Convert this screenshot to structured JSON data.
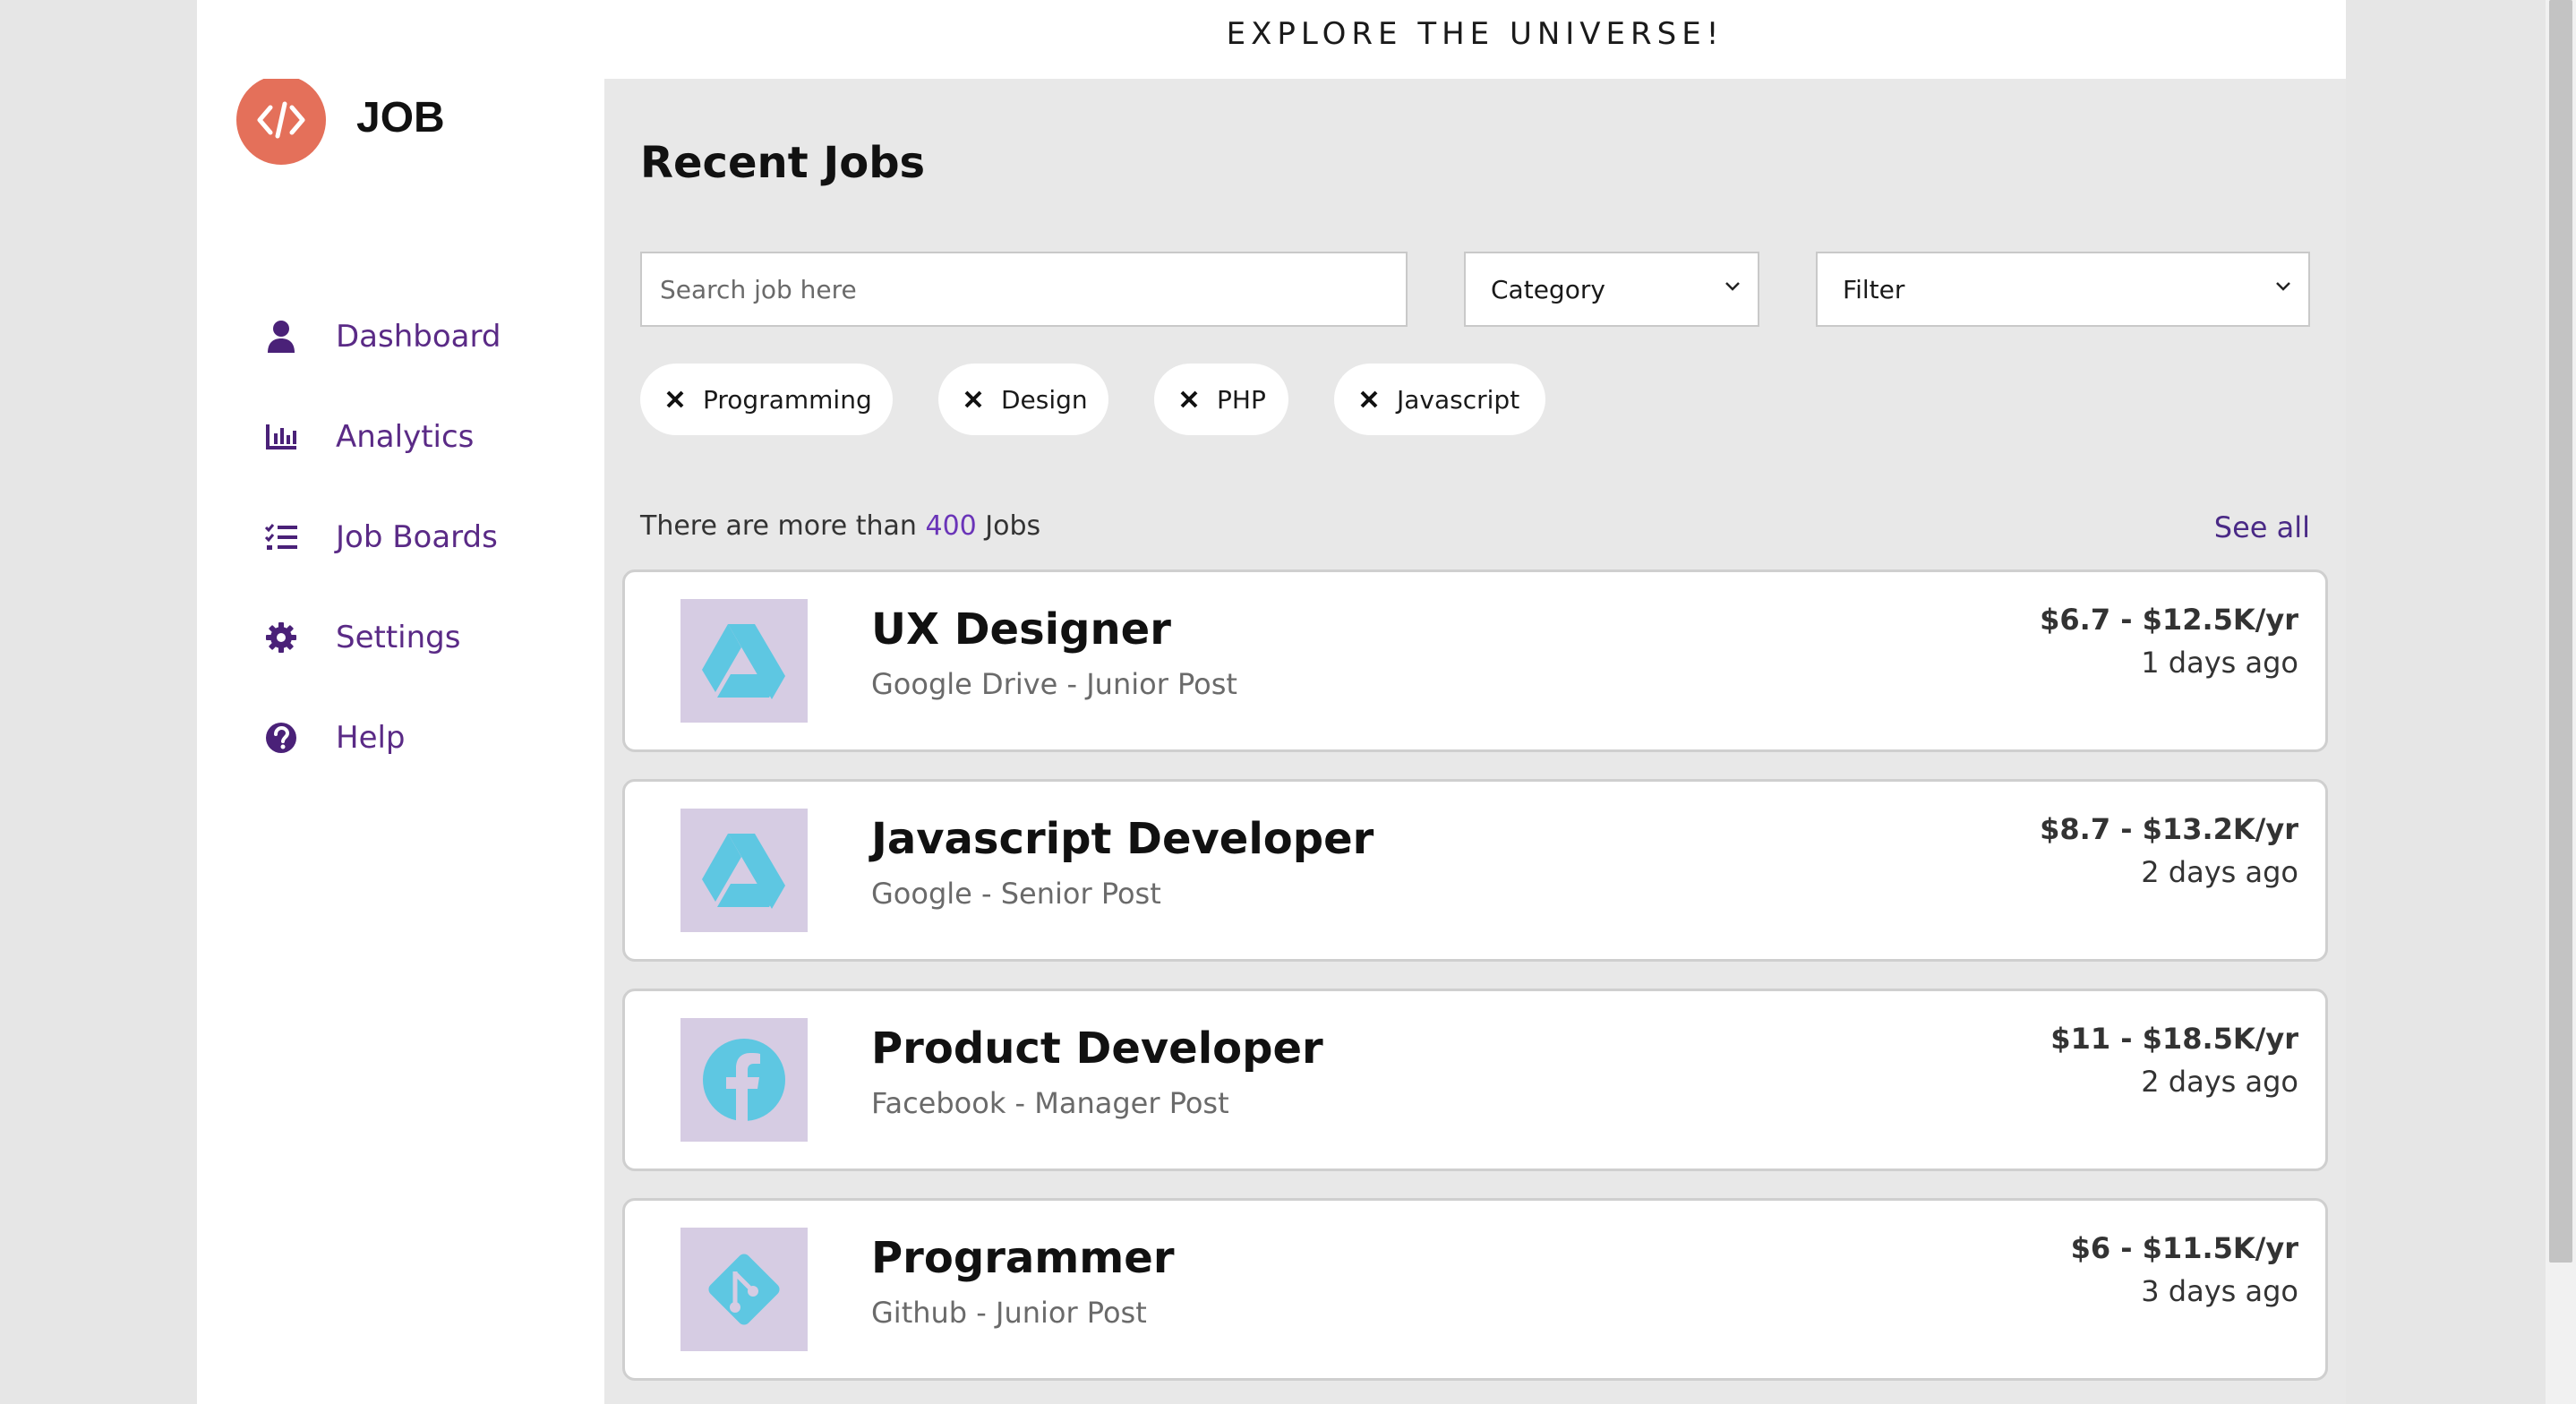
{
  "banner": {
    "text": "EXPLORE THE UNIVERSE!"
  },
  "brand": {
    "name": "JOB"
  },
  "sidebar": {
    "items": [
      {
        "label": "Dashboard",
        "icon": "user-icon"
      },
      {
        "label": "Analytics",
        "icon": "bar-chart-icon"
      },
      {
        "label": "Job Boards",
        "icon": "checklist-icon"
      },
      {
        "label": "Settings",
        "icon": "gear-icon"
      },
      {
        "label": "Help",
        "icon": "question-icon"
      }
    ]
  },
  "main": {
    "title": "Recent Jobs",
    "search": {
      "placeholder": "Search job here",
      "value": ""
    },
    "category_select": {
      "value": "Category"
    },
    "filter_select": {
      "value": "Filter"
    },
    "tags": [
      "Programming",
      "Design",
      "PHP",
      "Javascript"
    ],
    "count": {
      "prefix": "There are more than ",
      "number": "400",
      "suffix": " Jobs"
    },
    "see_all": "See all",
    "jobs": [
      {
        "title": "UX Designer",
        "subtitle": "Google Drive - Junior Post",
        "salary": "$6.7 - $12.5K/yr",
        "ago": "1 days ago",
        "logo": "google-drive-icon"
      },
      {
        "title": "Javascript Developer",
        "subtitle": "Google - Senior Post",
        "salary": "$8.7 - $13.2K/yr",
        "ago": "2 days ago",
        "logo": "google-drive-icon"
      },
      {
        "title": "Product Developer",
        "subtitle": "Facebook - Manager Post",
        "salary": "$11 - $18.5K/yr",
        "ago": "2 days ago",
        "logo": "facebook-icon"
      },
      {
        "title": "Programmer",
        "subtitle": "Github - Junior Post",
        "salary": "$6 - $11.5K/yr",
        "ago": "3 days ago",
        "logo": "git-icon"
      }
    ]
  },
  "colors": {
    "accent": "#5a2a86",
    "logo_bg": "#e4705a",
    "job_logo_bg": "#d6cce3",
    "job_logo_fg": "#5ec7e2",
    "count_highlight": "#6a34b8"
  }
}
